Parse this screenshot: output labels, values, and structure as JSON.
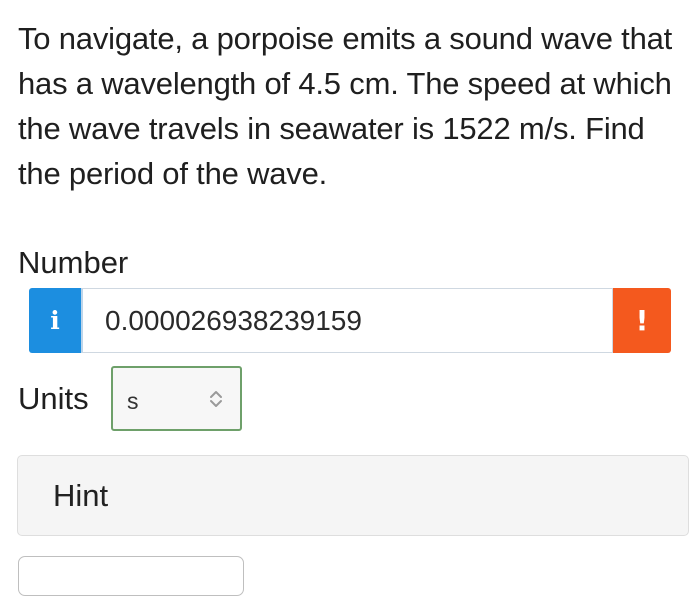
{
  "question": {
    "text": "To navigate, a porpoise emits a sound wave that has a wavelength of 4.5 cm. The speed at which the wave travels in seawater is 1522 m/s. Find the period of the wave."
  },
  "answer": {
    "label": "Number",
    "info_badge_glyph": "i",
    "value": "0.000026938239159",
    "alert_badge_glyph": "!",
    "info_color": "#1c8ee0",
    "alert_color": "#f4591e"
  },
  "units": {
    "label": "Units",
    "selected": "s",
    "icon": "select-chevrons-icon"
  },
  "hint": {
    "label": "Hint"
  },
  "colors": {
    "units_border": "#6ea06a",
    "hint_background": "#f5f5f5"
  }
}
